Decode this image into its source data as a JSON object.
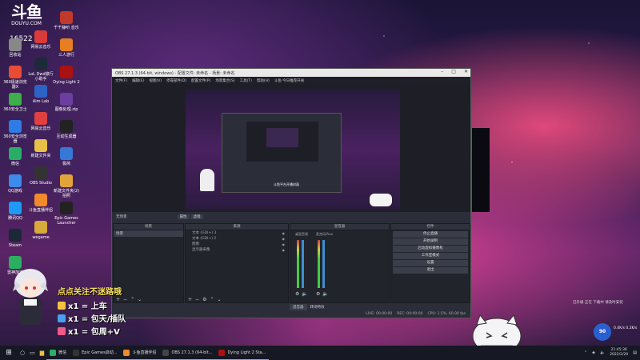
{
  "watermark": {
    "logo": "斗鱼",
    "domain": "DOUYU.COM",
    "room_id": "16522"
  },
  "desktop_icons": [
    {
      "label": "回收站",
      "color": "#888888"
    },
    {
      "label": "360极速浏览器X",
      "color": "#e94b35"
    },
    {
      "label": "360安全卫士",
      "color": "#3dae49"
    },
    {
      "label": "360安全浏览器",
      "color": "#2f7be5"
    },
    {
      "label": "微信",
      "color": "#2aae67"
    },
    {
      "label": "QQ游戏",
      "color": "#3d8bea"
    },
    {
      "label": "腾讯QQ",
      "color": "#1e9af5"
    },
    {
      "label": "Steam",
      "color": "#1b2838"
    },
    {
      "label": "雷神加速",
      "color": "#2cae60"
    },
    {
      "label": "网易云音乐",
      "color": "#d93b3b"
    },
    {
      "label": "LoL Dwd旅行 小助手",
      "color": "#1c2a3a"
    },
    {
      "label": "Aim Lab",
      "color": "#2b63c7"
    },
    {
      "label": "网易云音乐",
      "color": "#e04040"
    },
    {
      "label": "新建文件夹",
      "color": "#e8c04a"
    },
    {
      "label": "OBS Studio",
      "color": "#333333"
    },
    {
      "label": "斗鱼直播伴侣",
      "color": "#f08a2a"
    },
    {
      "label": "wegame",
      "color": "#d8a93b"
    },
    {
      "label": "千千静听 音乐",
      "color": "#c0392b"
    },
    {
      "label": "三人游行",
      "color": "#e67e22"
    },
    {
      "label": "Dying Light 2",
      "color": "#aa1111"
    },
    {
      "label": "图像处理.zip",
      "color": "#6a3fa0"
    },
    {
      "label": "互动生成器",
      "color": "#222222"
    },
    {
      "label": "极简",
      "color": "#3778d6"
    },
    {
      "label": "新建文件夹(2) 拍照",
      "color": "#e3a33b"
    },
    {
      "label": "Epic Games Launcher",
      "color": "#222222"
    }
  ],
  "obs": {
    "title": "OBS 27.1.3 (64-bit, windows) - 配置文件: 未命名 - 场景: 未命名",
    "menu": [
      "文件(F)",
      "编辑(E)",
      "视图(V)",
      "停靠部件(D)",
      "配置文件(P)",
      "场景集合(S)",
      "工具(T)",
      "帮助(H)",
      "斗鱼·今日推荐开关"
    ],
    "preview_caption": "斗鱼平台开播封面",
    "tabs": [
      "无场景",
      "属性",
      "滤镜"
    ],
    "docks": {
      "scenes": {
        "title": "场景",
        "items": [
          "场景"
        ]
      },
      "sources": {
        "title": "来源",
        "items": [
          "文本 (GDI+) 3",
          "文本 (GDI+) 2",
          "图像",
          "显示器采集"
        ]
      },
      "mixer": {
        "title": "混音器",
        "channels": [
          "桌面音频",
          "麦克风/Aux"
        ],
        "tabs": [
          "混音器",
          "转场特效"
        ]
      },
      "controls": {
        "title": "控件",
        "buttons": [
          "停止直播",
          "开始录制",
          "启动虚拟摄像机",
          "工作室模式",
          "设置",
          "退出"
        ]
      }
    },
    "status": [
      "LIVE: 00:00:00",
      "REC: 00:00:00",
      "CPU: 1.5%, 60.00 fps"
    ]
  },
  "overlay": {
    "headline": "点点关注不迷路哦",
    "lines": [
      {
        "text": "x1 = 上车",
        "color": "#f5c242"
      },
      {
        "text": "x1 = 包天/插队",
        "color": "#4aa0f0"
      },
      {
        "text": "x1 = 包周+V",
        "color": "#ee5a8a"
      }
    ]
  },
  "right_widget": {
    "text": "已升级 正在 下载中 请及时安装",
    "speed": "90",
    "speed_unit": "0.4K/s 0.2K/s"
  },
  "taskbar": {
    "items": [
      {
        "label": "微信",
        "color": "#2aae67"
      },
      {
        "label": "Epic Games启动...",
        "color": "#333333"
      },
      {
        "label": "斗鱼直播伴侣",
        "color": "#f08a2a"
      },
      {
        "label": "OBS 27.1.3 (64-bit...",
        "color": "#444444"
      },
      {
        "label": "Dying Light 2 Sta...",
        "color": "#aa1111"
      }
    ],
    "clock_time": "21:45:36",
    "clock_date": "2022/2/20"
  }
}
